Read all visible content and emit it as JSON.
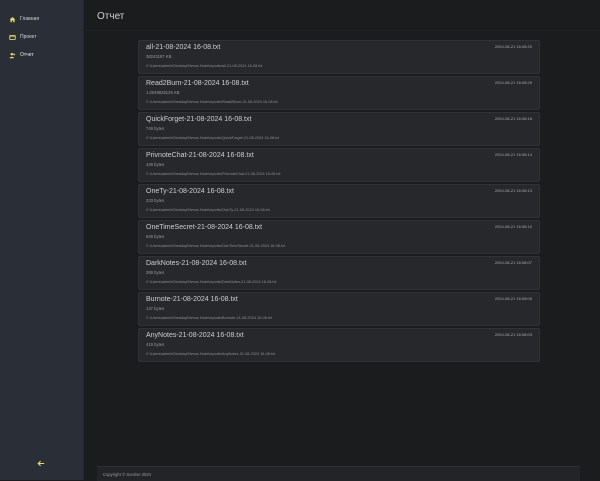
{
  "sidebar": {
    "items": [
      {
        "label": "Главная",
        "icon": "home-icon",
        "active": false
      },
      {
        "label": "Проект",
        "icon": "project-icon",
        "active": false
      },
      {
        "label": "Отчет",
        "icon": "users-icon",
        "active": true
      }
    ],
    "collapse_icon": "arrow-left-icon"
  },
  "main": {
    "title": "Отчет",
    "files": [
      {
        "name": "all-21-08-2024 16-08.txt",
        "size": "38243187 KB",
        "path": "C:\\Users\\admin\\Desktop\\Nexus Note\\reports\\all-21-08-2024 16-08.txt",
        "date": "2024-08-21 16:08:20"
      },
      {
        "name": "Read2Burn-21-08-2024 16-08.txt",
        "size": "1.0048828125 KB",
        "path": "C:\\Users\\admin\\Desktop\\Nexus Note\\reports\\Read2Burn-21-08-2024 16-08.txt",
        "date": "2024-08-21 16:08:25"
      },
      {
        "name": "QuickForget-21-08-2024 16-08.txt",
        "size": "749 bytes",
        "path": "C:\\Users\\admin\\Desktop\\Nexus Note\\reports\\QuickForget-21-08-2024 16-08.txt",
        "date": "2024-08-21 16:08:18"
      },
      {
        "name": "PrivnoteChat-21-08-2024 16-08.txt",
        "size": "428 bytes",
        "path": "C:\\Users\\admin\\Desktop\\Nexus Note\\reports\\PrivnoteChat-21-08-2024 16-08.txt",
        "date": "2024-08-21 16:08:14"
      },
      {
        "name": "OneTy-21-08-2024 16-08.txt",
        "size": "233 bytes",
        "path": "C:\\Users\\admin\\Desktop\\Nexus Note\\reports\\OneTy-21-08-2024 16-08.txt",
        "date": "2024-08-21 16:08:13"
      },
      {
        "name": "OneTimeSecret-21-08-2024 16-08.txt",
        "size": "648 bytes",
        "path": "C:\\Users\\admin\\Desktop\\Nexus Note\\reports\\OneTimeSecret-21-08-2024 16-08.txt",
        "date": "2024-08-21 16:08:10"
      },
      {
        "name": "DarkNotes-21-08-2024 16-08.txt",
        "size": "289 bytes",
        "path": "C:\\Users\\admin\\Desktop\\Nexus Note\\reports\\DarkNotes-21-08-2024 16-08.txt",
        "date": "2024-08-21 16:08:07"
      },
      {
        "name": "Burnote-21-08-2024 16-08.txt",
        "size": "137 bytes",
        "path": "C:\\Users\\admin\\Desktop\\Nexus Note\\reports\\Burnote-21-08-2024 16-08.txt",
        "date": "2024-08-21 16:08:05"
      },
      {
        "name": "AnyNotes-21-08-2024 16-08.txt",
        "size": "419 bytes",
        "path": "C:\\Users\\admin\\Desktop\\Nexus Note\\reports\\AnyNotes-21-08-2024 16-08.txt",
        "date": "2024-08-21 16:08:03"
      }
    ]
  },
  "footer": {
    "text": "Copyright © Sunrise 2024"
  },
  "colors": {
    "accent": "#e3d86a",
    "sidebar": "#2a2e37",
    "background": "#1b1c1e",
    "card": "#26282b"
  }
}
